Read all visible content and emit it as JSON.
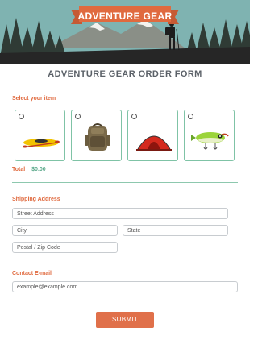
{
  "header": {
    "banner_text": "ADVENTURE GEAR",
    "form_title": "ADVENTURE GEAR ORDER FORM"
  },
  "items_section": {
    "label": "Select your item",
    "products": [
      {
        "icon": "kayak-icon"
      },
      {
        "icon": "backpack-icon"
      },
      {
        "icon": "tent-icon"
      },
      {
        "icon": "fishing-lure-icon"
      }
    ]
  },
  "total": {
    "label": "Total",
    "value": "$0.00"
  },
  "shipping": {
    "label": "Shipping Address",
    "street_placeholder": "Street Address",
    "city_placeholder": "City",
    "state_placeholder": "State",
    "postal_placeholder": "Postal / Zip Code"
  },
  "contact": {
    "label": "Contact E-mail",
    "email_placeholder": "example@example.com"
  },
  "submit_label": "SUBMIT",
  "colors": {
    "accent": "#e06a3f",
    "teal": "#5aa88a",
    "sky": "#6fa6a8"
  }
}
